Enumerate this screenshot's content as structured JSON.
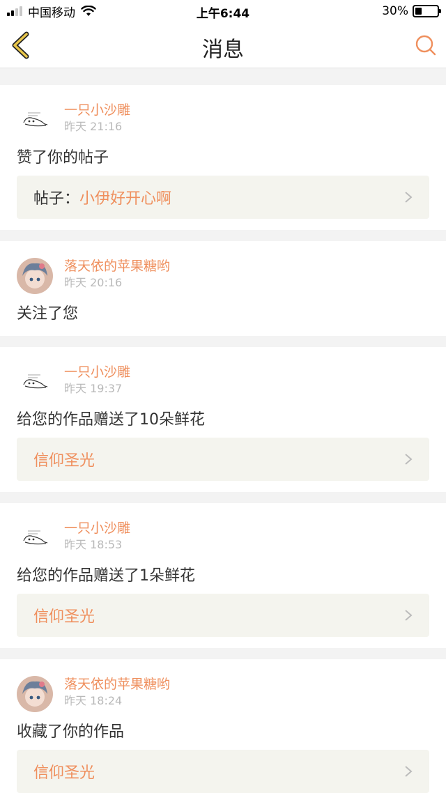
{
  "status_bar": {
    "carrier": "中国移动",
    "time": "上午6:44",
    "battery_pct": "30%",
    "battery_level": 0.3
  },
  "nav": {
    "back_icon": "back-chevron-icon",
    "title": "消息",
    "search_icon": "search-icon"
  },
  "colors": {
    "accent": "#ef8f5d",
    "back_accent": "#e8c64a",
    "post_box_bg": "#f4f4ee"
  },
  "messages": [
    {
      "user": "一只小沙雕",
      "time": "昨天 21:16",
      "action": "赞了你的帖子",
      "post_prefix": "帖子：",
      "post_title": "小伊好开心啊"
    },
    {
      "user": "落天依的苹果糖哟",
      "time": "昨天 20:16",
      "action": "关注了您"
    },
    {
      "user": "一只小沙雕",
      "time": "昨天 19:37",
      "action": "给您的作品赠送了10朵鲜花",
      "post_prefix": "",
      "post_title": "信仰圣光"
    },
    {
      "user": "一只小沙雕",
      "time": "昨天 18:53",
      "action": "给您的作品赠送了1朵鲜花",
      "post_prefix": "",
      "post_title": "信仰圣光"
    },
    {
      "user": "落天依的苹果糖哟",
      "time": "昨天 18:24",
      "action": "收藏了你的作品",
      "post_prefix": "",
      "post_title": "信仰圣光"
    }
  ]
}
